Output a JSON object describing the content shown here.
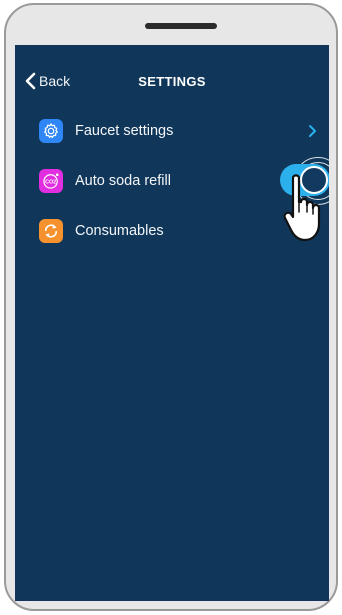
{
  "header": {
    "back_label": "Back",
    "title": "SETTINGS"
  },
  "settings": {
    "items": [
      {
        "label": "Faucet settings",
        "icon": "gear-icon",
        "color": "#2f86f6",
        "accessory": "chevron-right-icon"
      },
      {
        "label": "Auto soda refill",
        "icon": "co2-icon",
        "color": "#e02ee0",
        "accessory": "toggle",
        "icon_text": "CO2"
      },
      {
        "label": "Consumables",
        "icon": "refresh-icon",
        "color": "#f5922e",
        "accessory": "none"
      }
    ]
  },
  "auto_refill_toggle": {
    "state": "on",
    "on_color": "#2bb0ec"
  },
  "colors": {
    "screen_background": "#10375a",
    "phone_frame": "#e7e7e7",
    "accent": "#2bb0ec"
  },
  "gesture": {
    "type": "tap",
    "icon": "pointing-hand-icon"
  }
}
